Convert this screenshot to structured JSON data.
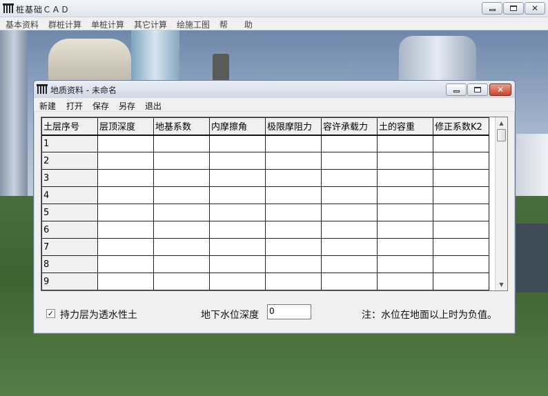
{
  "main_window": {
    "title": "桩基础ＣＡＤ",
    "menu": [
      "基本资料",
      "群桩计算",
      "单桩计算",
      "其它计算",
      "绘施工图",
      "帮",
      "助"
    ]
  },
  "dialog": {
    "title": "地质资料 - 未命名",
    "menu": [
      "新建",
      "打开",
      "保存",
      "另存",
      "退出"
    ],
    "grid": {
      "columns": [
        "土层序号",
        "层顶深度",
        "地基系数",
        "内摩擦角",
        "极限摩阻力",
        "容许承载力",
        "土的容重",
        "修正系数K2"
      ],
      "rows": [
        "1",
        "2",
        "3",
        "4",
        "5",
        "6",
        "7",
        "8",
        "9"
      ]
    },
    "checkbox_label": "持力层为透水性土",
    "checkbox_checked": true,
    "water_depth_label": "地下水位深度",
    "water_depth_value": "0",
    "note": "注：水位在地面以上时为负值。"
  },
  "icons": {
    "app": "pile-foundation-icon",
    "minimize": "minimize-icon",
    "maximize": "maximize-icon",
    "close": "close-icon",
    "scroll_up": "scroll-up-arrow-icon",
    "scroll_down": "scroll-down-arrow-icon",
    "check": "checkmark-icon"
  }
}
